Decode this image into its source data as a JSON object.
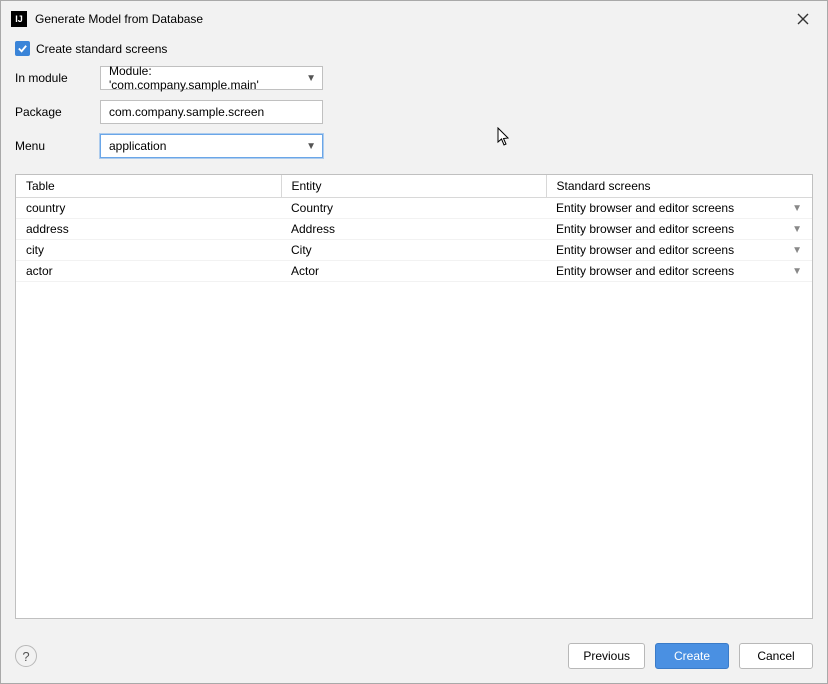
{
  "titlebar": {
    "app_icon_text": "IJ",
    "title": "Generate Model from Database"
  },
  "form": {
    "checkbox_label": "Create standard screens",
    "checkbox_checked": true,
    "module_label": "In module",
    "module_value": "Module: 'com.company.sample.main'",
    "package_label": "Package",
    "package_value": "com.company.sample.screen",
    "menu_label": "Menu",
    "menu_value": "application"
  },
  "table": {
    "headers": {
      "table": "Table",
      "entity": "Entity",
      "screens": "Standard screens"
    },
    "rows": [
      {
        "table": "country",
        "entity": "Country",
        "screens": "Entity browser and editor screens"
      },
      {
        "table": "address",
        "entity": "Address",
        "screens": "Entity browser and editor screens"
      },
      {
        "table": "city",
        "entity": "City",
        "screens": "Entity browser and editor screens"
      },
      {
        "table": "actor",
        "entity": "Actor",
        "screens": "Entity browser and editor screens"
      }
    ]
  },
  "footer": {
    "help": "?",
    "previous": "Previous",
    "create": "Create",
    "cancel": "Cancel"
  }
}
